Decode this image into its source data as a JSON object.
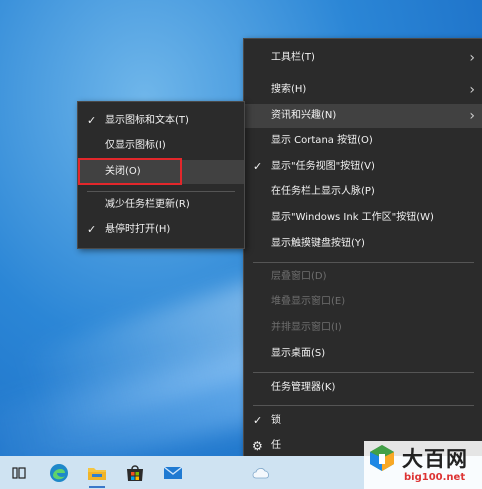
{
  "main_menu": {
    "items": [
      {
        "label": "工具栏(T)"
      },
      {
        "label": "搜索(H)"
      },
      {
        "label": "资讯和兴趣(N)"
      },
      {
        "label": "显示 Cortana 按钮(O)"
      },
      {
        "label": "显示\"任务视图\"按钮(V)"
      },
      {
        "label": "在任务栏上显示人脉(P)"
      },
      {
        "label": "显示\"Windows Ink 工作区\"按钮(W)"
      },
      {
        "label": "显示触摸键盘按钮(Y)"
      },
      {
        "label": "层叠窗口(D)"
      },
      {
        "label": "堆叠显示窗口(E)"
      },
      {
        "label": "并排显示窗口(I)"
      },
      {
        "label": "显示桌面(S)"
      },
      {
        "label": "任务管理器(K)"
      },
      {
        "label": "锁"
      },
      {
        "label": "任"
      }
    ]
  },
  "sub_menu": {
    "items": [
      {
        "label": "显示图标和文本(T)"
      },
      {
        "label": "仅显示图标(I)"
      },
      {
        "label": "关闭(O)"
      },
      {
        "label": "减少任务栏更新(R)"
      },
      {
        "label": "悬停时打开(H)"
      }
    ]
  },
  "watermark": {
    "title": "大百网",
    "url": "big100.net"
  },
  "colors": {
    "menu_bg": "#2b2b2b",
    "highlight_border": "#e3272b",
    "taskbar_bg": "#cfe3f2"
  }
}
